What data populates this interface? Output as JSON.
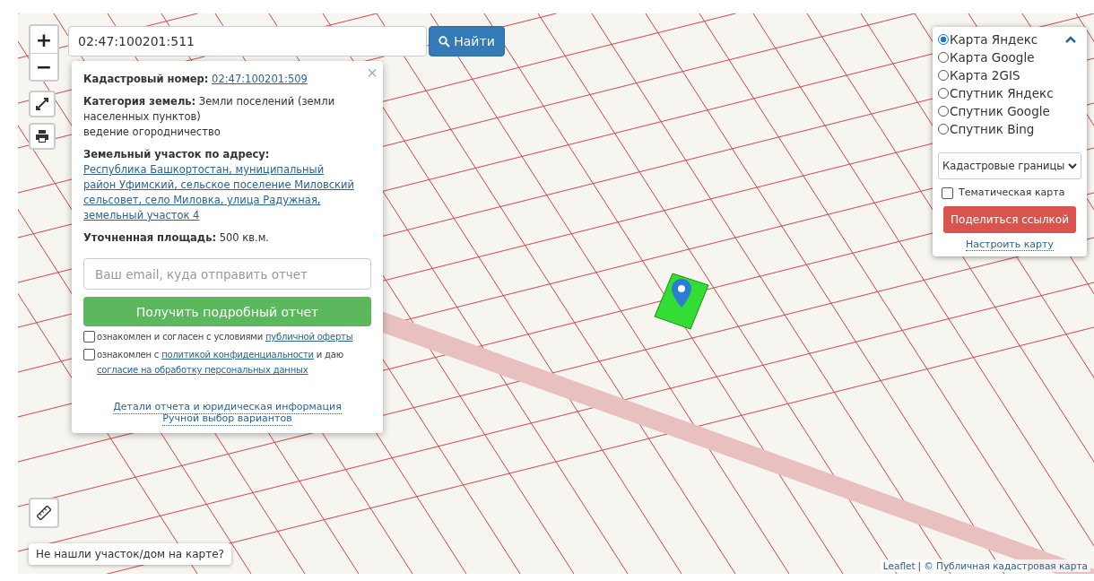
{
  "zoom_controls": [
    {
      "label": "+"
    },
    {
      "label": "−"
    }
  ],
  "search": {
    "value": "02:47:100201:511",
    "button": "Найти"
  },
  "popup": {
    "close": "×",
    "fields": [
      {
        "kind": "link",
        "label": "Кадастровый номер:",
        "value": "02:47:100201:509"
      },
      {
        "kind": "text",
        "label": "Категория земель:",
        "value": "Земли поселений (земли населенных пунктов)",
        "extra": "ведение огородничество"
      },
      {
        "kind": "link",
        "label": "Земельный участок по адресу:",
        "value": "Республика Башкортостан, муниципальный район Уфимский, сельское поселение Миловский сельсовет, село Миловка, улица Радужная, земельный участок 4"
      },
      {
        "kind": "text",
        "label": "Уточненная площадь:",
        "value": "500 кв.м."
      }
    ],
    "email_placeholder": "Ваш email, куда отправить отчет",
    "report_button": "Получить подробный отчет",
    "agreements": [
      {
        "checked": false,
        "text": "ознакомлен и согласен с условиями",
        "link": "публичной оферты"
      },
      {
        "checked": false,
        "text": "ознакомлен с",
        "link": "политикой конфиденциальности",
        "text2": "и даю",
        "link2": "согласие на обработку персональных данных"
      }
    ],
    "links": [
      "Детали отчета и юридическая информация",
      "Ручной выбор вариантов"
    ]
  },
  "layers": {
    "options": [
      {
        "label": "Карта Яндекс",
        "selected": true
      },
      {
        "label": "Карта Google",
        "selected": false
      },
      {
        "label": "Карта 2GIS",
        "selected": false
      },
      {
        "label": "Спутник Яндекс",
        "selected": false
      },
      {
        "label": "Спутник Google",
        "selected": false
      },
      {
        "label": "Спутник Bing",
        "selected": false
      }
    ],
    "overlay_select": "Кадастровые границы",
    "thematic": {
      "label": "Тематическая карта",
      "checked": false
    },
    "share_button": "Поделиться ссылкой",
    "settings_link": "Настроить карту"
  },
  "not_found_button": "Не нашли участок/дом на карте?",
  "attribution": {
    "leaflet": "Leaflet",
    "separator": "|",
    "source": "© Публичная кадастровая карта"
  }
}
